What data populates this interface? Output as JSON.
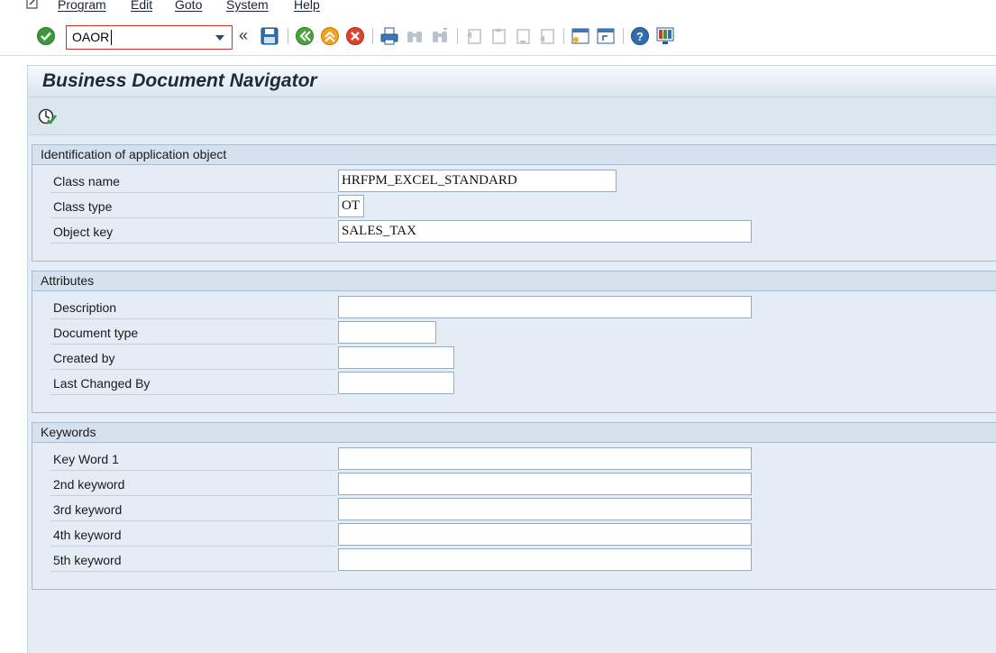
{
  "menu": {
    "items": [
      "Program",
      "Edit",
      "Goto",
      "System",
      "Help"
    ]
  },
  "toolbar": {
    "command_value": "OAOR",
    "icons": [
      "enter-check-icon",
      "save-icon",
      "back-icon",
      "exit-icon",
      "cancel-icon",
      "print-icon",
      "find-icon",
      "find-next-icon",
      "first-page-icon",
      "previous-page-icon",
      "next-page-icon",
      "last-page-icon",
      "create-session-icon",
      "shortcut-icon",
      "help-icon",
      "customize-layout-icon"
    ]
  },
  "page": {
    "title": "Business Document Navigator"
  },
  "groups": {
    "identification": {
      "header": "Identification of application object",
      "fields": [
        {
          "label": "Class name",
          "value": "HRFPM_EXCEL_STANDARD"
        },
        {
          "label": "Class type",
          "value": "OT"
        },
        {
          "label": "Object key",
          "value": "SALES_TAX"
        }
      ]
    },
    "attributes": {
      "header": "Attributes",
      "fields": [
        {
          "label": "Description",
          "value": ""
        },
        {
          "label": "Document type",
          "value": ""
        },
        {
          "label": "Created by",
          "value": ""
        },
        {
          "label": "Last Changed By",
          "value": ""
        }
      ]
    },
    "keywords": {
      "header": "Keywords",
      "fields": [
        {
          "label": "Key Word 1",
          "value": ""
        },
        {
          "label": "2nd keyword",
          "value": ""
        },
        {
          "label": "3rd keyword",
          "value": ""
        },
        {
          "label": "4th keyword",
          "value": ""
        },
        {
          "label": "5th keyword",
          "value": ""
        }
      ]
    }
  },
  "colors": {
    "accent": "#2b6aa3",
    "panel": "#e4edf5",
    "header": "#d5e2ee"
  }
}
